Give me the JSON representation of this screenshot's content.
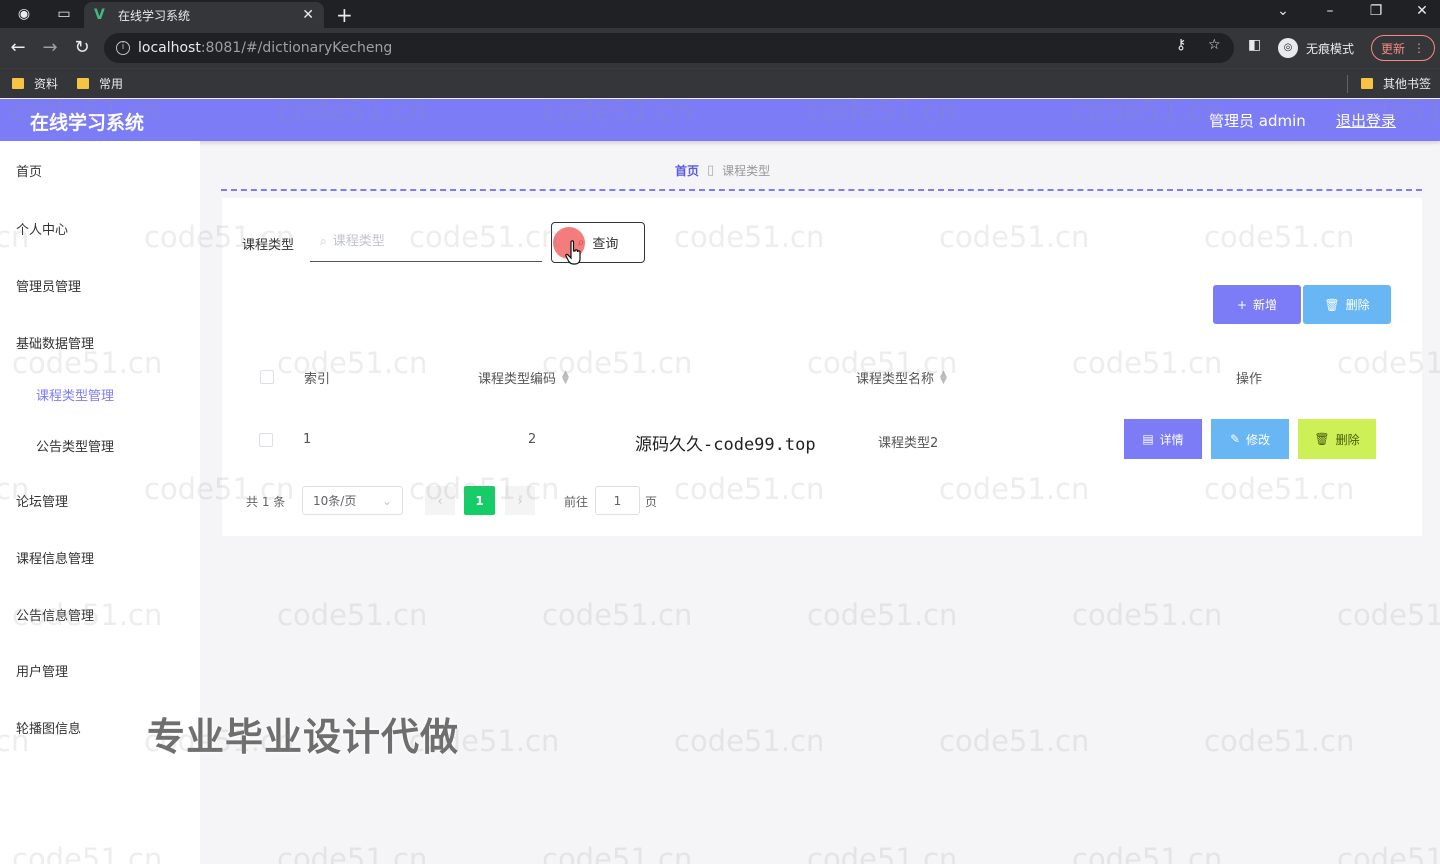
{
  "browser": {
    "tab_title": "在线学习系统",
    "url_host": "localhost",
    "url_rest": ":8081/#/dictionaryKecheng",
    "incognito_label": "无痕模式",
    "update_label": "更新",
    "bookmarks": [
      "资料",
      "常用"
    ],
    "other_bookmarks": "其他书签"
  },
  "header": {
    "title": "在线学习系统",
    "user": "管理员 admin",
    "logout": "退出登录"
  },
  "sidebar": {
    "items": [
      {
        "label": "首页"
      },
      {
        "label": "个人中心"
      },
      {
        "label": "管理员管理"
      },
      {
        "label": "基础数据管理"
      },
      {
        "label": "课程类型管理",
        "active": true
      },
      {
        "label": "公告类型管理"
      },
      {
        "label": "论坛管理"
      },
      {
        "label": "课程信息管理"
      },
      {
        "label": "公告信息管理"
      },
      {
        "label": "用户管理"
      },
      {
        "label": "轮播图信息"
      }
    ]
  },
  "breadcrumb": {
    "home": "首页",
    "current": "课程类型"
  },
  "search": {
    "label": "课程类型",
    "placeholder": "课程类型",
    "query_button": "查询"
  },
  "actions": {
    "add": "新增",
    "delete": "删除"
  },
  "table": {
    "columns": {
      "index": "索引",
      "code": "课程类型编码",
      "name": "课程类型名称",
      "ops": "操作"
    },
    "rows": [
      {
        "index": "1",
        "code": "2",
        "name": "课程类型2"
      }
    ],
    "row_buttons": {
      "detail": "详情",
      "edit": "修改",
      "remove": "删除"
    }
  },
  "pagination": {
    "total": "共 1 条",
    "page_size": "10条/页",
    "current_page": "1",
    "goto_label": "前往",
    "goto_value": "1",
    "page_suffix": "页"
  },
  "overlay": {
    "source_text": "源码久久-code99.top",
    "promo": "专业毕业设计代做",
    "watermark": "code51.cn"
  },
  "colors": {
    "accent": "#7c7cf7",
    "info": "#69b6f5",
    "warn": "#ccf055",
    "pager_active": "#13ce66"
  }
}
